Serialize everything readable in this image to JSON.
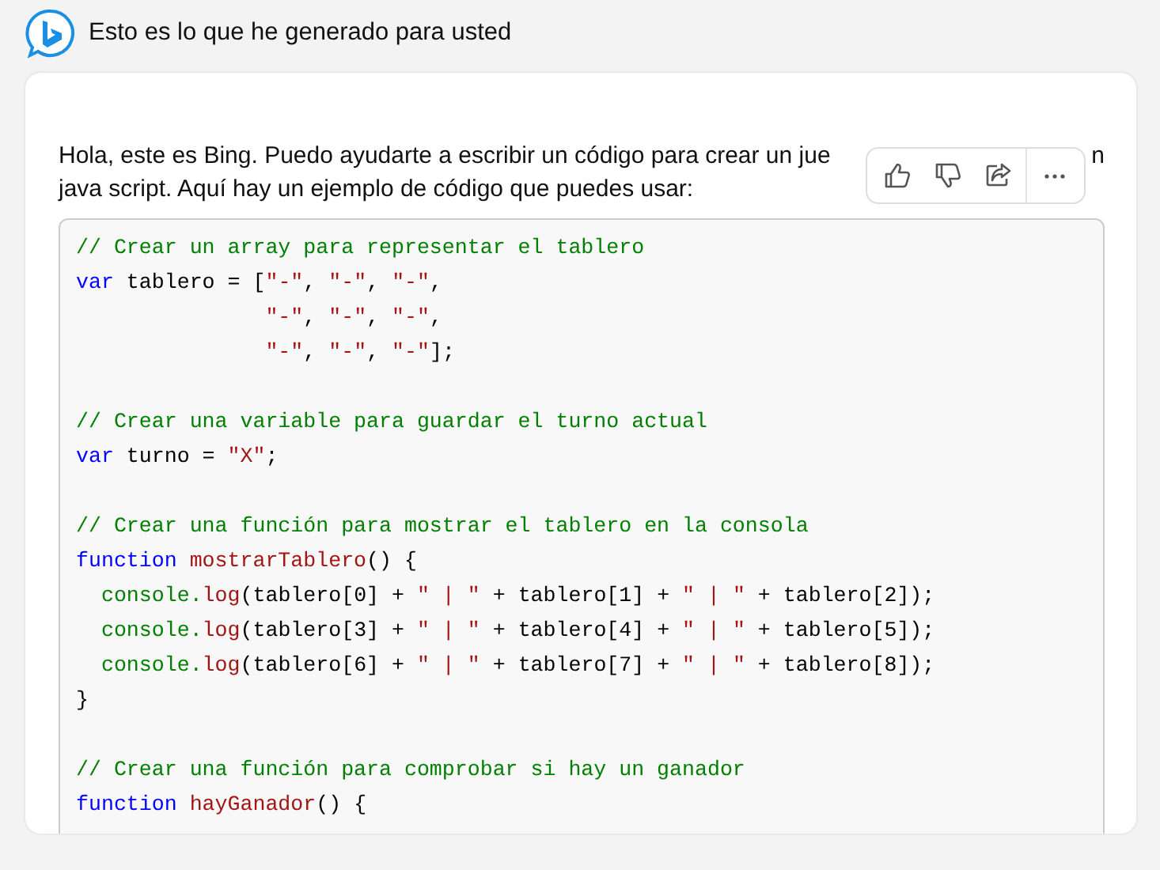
{
  "header": {
    "title": "Esto es lo que he generado para usted"
  },
  "message": {
    "line1_start": "Hola, este es Bing. Puedo ayudarte a escribir un código para crear un jue",
    "line1_end": "n",
    "line2": "java script. Aquí hay un ejemplo de código que puedes usar:"
  },
  "toolbar": {
    "buttons": [
      {
        "kind": "like"
      },
      {
        "kind": "dislike"
      },
      {
        "kind": "share"
      },
      {
        "kind": "more"
      }
    ]
  },
  "code_blocks": [
    [
      [
        {
          "kind": "comment",
          "text": "// Crear un array para representar el tablero"
        }
      ],
      [
        {
          "kind": "keyword",
          "text": "var"
        },
        {
          "kind": "plain",
          "text": " tablero = ["
        },
        {
          "kind": "string",
          "text": "\"-\""
        },
        {
          "kind": "plain",
          "text": ", "
        },
        {
          "kind": "string",
          "text": "\"-\""
        },
        {
          "kind": "plain",
          "text": ", "
        },
        {
          "kind": "string",
          "text": "\"-\""
        },
        {
          "kind": "plain",
          "text": ","
        }
      ],
      [
        {
          "kind": "string",
          "text": "               \"-\""
        },
        {
          "kind": "plain",
          "text": ", "
        },
        {
          "kind": "string",
          "text": "\"-\""
        },
        {
          "kind": "plain",
          "text": ", "
        },
        {
          "kind": "string",
          "text": "\"-\""
        },
        {
          "kind": "plain",
          "text": ","
        }
      ],
      [
        {
          "kind": "string",
          "text": "               \"-\""
        },
        {
          "kind": "plain",
          "text": ", "
        },
        {
          "kind": "string",
          "text": "\"-\""
        },
        {
          "kind": "plain",
          "text": ", "
        },
        {
          "kind": "string",
          "text": "\"-\""
        },
        {
          "kind": "plain",
          "text": "];"
        }
      ]
    ],
    [
      [
        {
          "kind": "comment",
          "text": "// Crear una variable para guardar el turno actual"
        }
      ],
      [
        {
          "kind": "keyword",
          "text": "var"
        },
        {
          "kind": "plain",
          "text": " turno = "
        },
        {
          "kind": "string",
          "text": "\"X\""
        },
        {
          "kind": "plain",
          "text": ";"
        }
      ]
    ],
    [
      [
        {
          "kind": "comment",
          "text": "// Crear una función para mostrar el tablero en la consola"
        }
      ],
      [
        {
          "kind": "keyword",
          "text": "function"
        },
        {
          "kind": "name",
          "text": " mostrarTablero"
        },
        {
          "kind": "plain",
          "text": "() {"
        }
      ],
      [
        {
          "kind": "builtin",
          "text": "  console."
        },
        {
          "kind": "name",
          "text": "log"
        },
        {
          "kind": "plain",
          "text": "(tablero[0] + "
        },
        {
          "kind": "string",
          "text": "\" | \""
        },
        {
          "kind": "plain",
          "text": " + tablero[1] + "
        },
        {
          "kind": "string",
          "text": "\" | \""
        },
        {
          "kind": "plain",
          "text": " + tablero[2]);"
        }
      ],
      [
        {
          "kind": "builtin",
          "text": "  console."
        },
        {
          "kind": "name",
          "text": "log"
        },
        {
          "kind": "plain",
          "text": "(tablero[3] + "
        },
        {
          "kind": "string",
          "text": "\" | \""
        },
        {
          "kind": "plain",
          "text": " + tablero[4] + "
        },
        {
          "kind": "string",
          "text": "\" | \""
        },
        {
          "kind": "plain",
          "text": " + tablero[5]);"
        }
      ],
      [
        {
          "kind": "builtin",
          "text": "  console."
        },
        {
          "kind": "name",
          "text": "log"
        },
        {
          "kind": "plain",
          "text": "(tablero[6] + "
        },
        {
          "kind": "string",
          "text": "\" | \""
        },
        {
          "kind": "plain",
          "text": " + tablero[7] + "
        },
        {
          "kind": "string",
          "text": "\" | \""
        },
        {
          "kind": "plain",
          "text": " + tablero[8]);"
        }
      ],
      [
        {
          "kind": "plain",
          "text": "}"
        }
      ]
    ],
    [
      [
        {
          "kind": "comment",
          "text": "// Crear una función para comprobar si hay un ganador"
        }
      ],
      [
        {
          "kind": "keyword",
          "text": "function"
        },
        {
          "kind": "name",
          "text": " hayGanador"
        },
        {
          "kind": "plain",
          "text": "() {"
        }
      ]
    ]
  ]
}
